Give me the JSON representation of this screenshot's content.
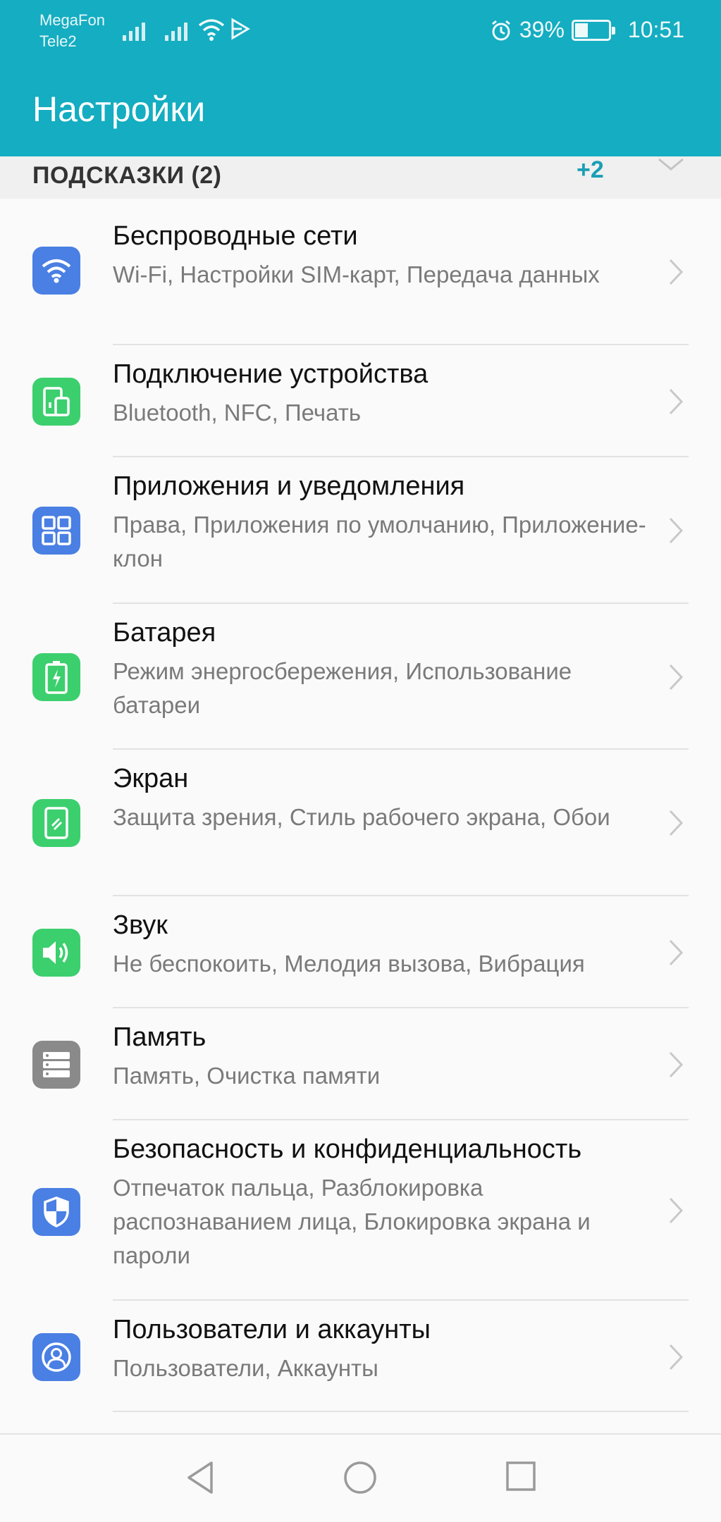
{
  "status_bar": {
    "carrier_1": "MegaFon",
    "carrier_2": "Tele2",
    "battery": "39%",
    "time": "10:51",
    "icons": [
      "signal-icon",
      "signal-icon",
      "wifi-icon",
      "cast-icon",
      "alarm-icon",
      "battery-icon"
    ]
  },
  "app_bar": {
    "title": "Настройки"
  },
  "hints": {
    "label": "ПОДСКАЗКИ (2)",
    "count": "+2"
  },
  "settings": [
    {
      "title": "Беспроводные сети",
      "subtitle": "Wi-Fi, Настройки SIM-карт, Передача данных",
      "icon": "wifi-icon",
      "color": "#4a7fe3"
    },
    {
      "title": "Подключение устройства",
      "subtitle": "Bluetooth, NFC, Печать",
      "icon": "device-connection-icon",
      "color": "#3ccf6e"
    },
    {
      "title": "Приложения и уведомления",
      "subtitle": "Права, Приложения по умолчанию, Приложение-клон",
      "icon": "apps-grid-icon",
      "color": "#4a7fe3"
    },
    {
      "title": "Батарея",
      "subtitle": "Режим энергосбережения, Использование батареи",
      "icon": "battery-icon",
      "color": "#3ccf6e"
    },
    {
      "title": "Экран",
      "subtitle": "Защита зрения, Стиль рабочего экрана, Обои",
      "icon": "display-icon",
      "color": "#3ccf6e"
    },
    {
      "title": "Звук",
      "subtitle": "Не беспокоить, Мелодия вызова, Вибрация",
      "icon": "speaker-icon",
      "color": "#3ccf6e"
    },
    {
      "title": "Память",
      "subtitle": "Память, Очистка памяти",
      "icon": "storage-icon",
      "color": "#8a8a8a"
    },
    {
      "title": "Безопасность и конфиденциальность",
      "subtitle": "Отпечаток пальца, Разблокировка распознаванием лица, Блокировка экрана и пароли",
      "icon": "shield-icon",
      "color": "#4a7fe3"
    },
    {
      "title": "Пользователи и аккаунты",
      "subtitle": "Пользователи, Аккаунты",
      "icon": "user-icon",
      "color": "#4a7fe3"
    }
  ],
  "nav_bar": {
    "icons": [
      "back-icon",
      "home-icon",
      "recents-icon"
    ]
  }
}
